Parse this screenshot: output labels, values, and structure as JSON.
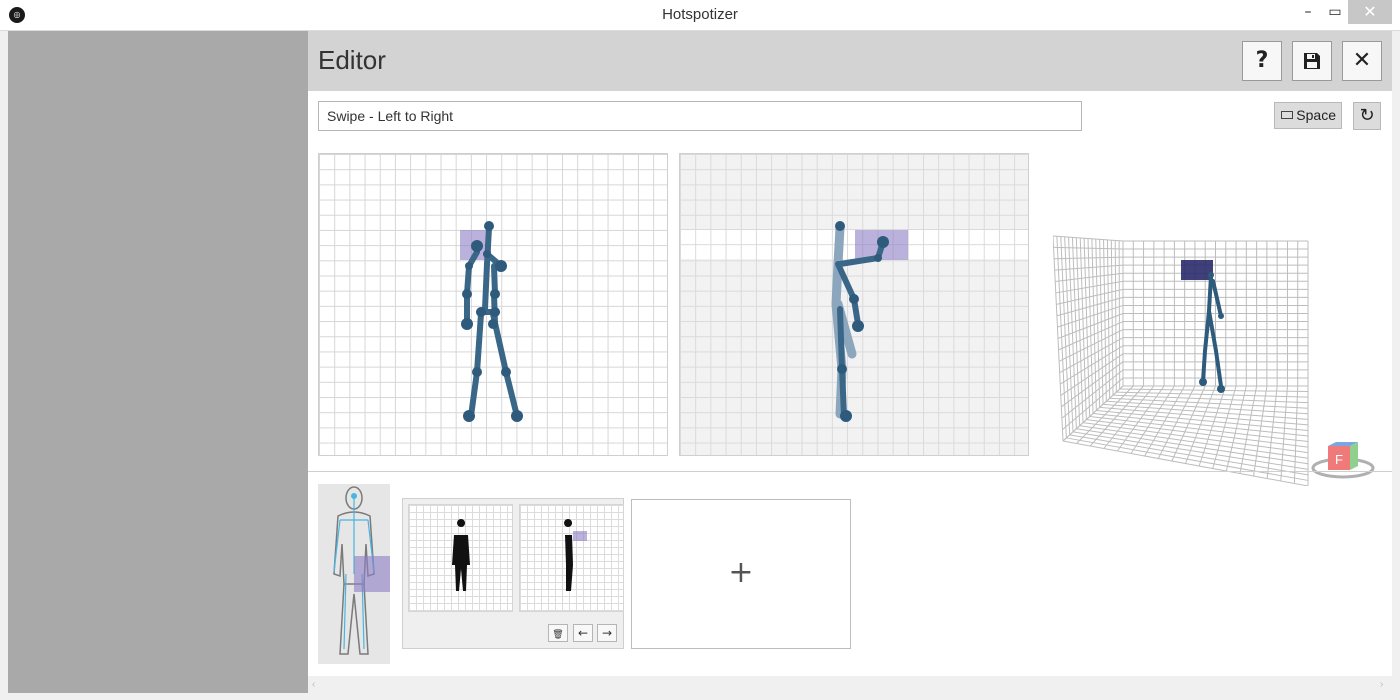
{
  "window": {
    "title": "Hotspotizer",
    "app_icon": "app-logo-icon",
    "minimize_glyph": "–",
    "maximize_glyph": "▭",
    "close_glyph": "✕"
  },
  "editor": {
    "title": "Editor",
    "help_label": "?",
    "save_icon": "save-icon",
    "close_label": "✕"
  },
  "gesture": {
    "name": "Swipe - Left to Right"
  },
  "toolbar": {
    "space_label": "Space",
    "reset_icon": "refresh-icon",
    "reset_glyph": "↻"
  },
  "cube": {
    "face_label": "F"
  },
  "timeline": {
    "add_label": "+",
    "frame_buttons": {
      "delete_glyph": "🗑",
      "prev_glyph": "←",
      "next_glyph": "→"
    }
  },
  "colors": {
    "hotspot": "#8c7fc4",
    "skeleton": "#2e5a7c",
    "header_bg": "#d3d3d3",
    "left_pane": "#a9a9a9"
  }
}
